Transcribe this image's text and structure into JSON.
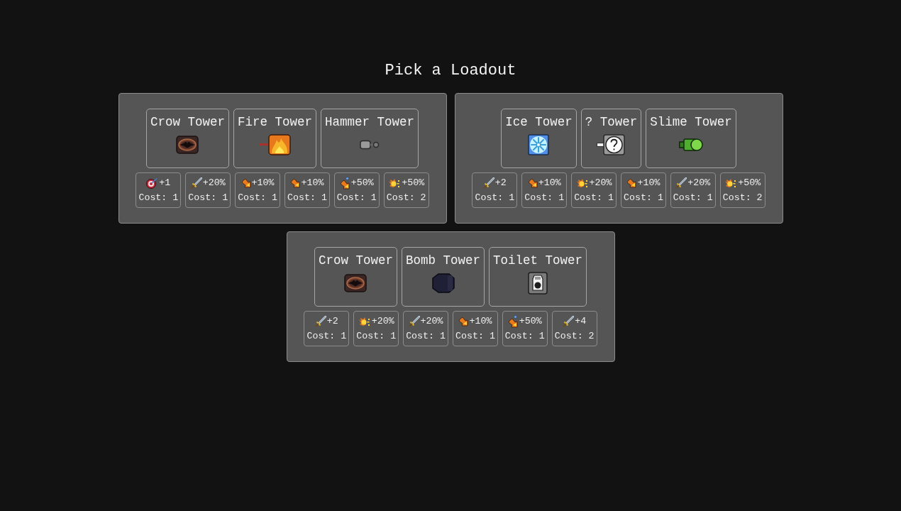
{
  "title": "Pick a Loadout",
  "loadouts": [
    {
      "towers": [
        {
          "name": "Crow Tower",
          "kind": "crow"
        },
        {
          "name": "Fire Tower",
          "kind": "fire"
        },
        {
          "name": "Hammer Tower",
          "kind": "hammer"
        }
      ],
      "upgrades": [
        {
          "kind": "target",
          "bonus": "+1",
          "cost": "Cost: 1"
        },
        {
          "kind": "sword",
          "bonus": "+20%",
          "cost": "Cost: 1"
        },
        {
          "kind": "flame-arrow",
          "bonus": "+10%",
          "cost": "Cost: 1"
        },
        {
          "kind": "flame-arrow",
          "bonus": "+10%",
          "cost": "Cost: 1"
        },
        {
          "kind": "gem-arrow",
          "bonus": "+50%",
          "cost": "Cost: 1"
        },
        {
          "kind": "fireball",
          "bonus": "+50%",
          "cost": "Cost: 2"
        }
      ]
    },
    {
      "towers": [
        {
          "name": "Ice Tower",
          "kind": "ice"
        },
        {
          "name": "? Tower",
          "kind": "mystery"
        },
        {
          "name": "Slime Tower",
          "kind": "slime"
        }
      ],
      "upgrades": [
        {
          "kind": "sword",
          "bonus": "+2",
          "cost": "Cost: 1"
        },
        {
          "kind": "flame-arrow",
          "bonus": "+10%",
          "cost": "Cost: 1"
        },
        {
          "kind": "fireball",
          "bonus": "+20%",
          "cost": "Cost: 1"
        },
        {
          "kind": "flame-arrow",
          "bonus": "+10%",
          "cost": "Cost: 1"
        },
        {
          "kind": "sword",
          "bonus": "+20%",
          "cost": "Cost: 1"
        },
        {
          "kind": "fireball",
          "bonus": "+50%",
          "cost": "Cost: 2"
        }
      ]
    },
    {
      "towers": [
        {
          "name": "Crow Tower",
          "kind": "crow"
        },
        {
          "name": "Bomb Tower",
          "kind": "bomb"
        },
        {
          "name": "Toilet Tower",
          "kind": "toilet"
        }
      ],
      "upgrades": [
        {
          "kind": "sword",
          "bonus": "+2",
          "cost": "Cost: 1"
        },
        {
          "kind": "fireball",
          "bonus": "+20%",
          "cost": "Cost: 1"
        },
        {
          "kind": "sword",
          "bonus": "+20%",
          "cost": "Cost: 1"
        },
        {
          "kind": "flame-arrow",
          "bonus": "+10%",
          "cost": "Cost: 1"
        },
        {
          "kind": "gem-arrow",
          "bonus": "+50%",
          "cost": "Cost: 1"
        },
        {
          "kind": "sword",
          "bonus": "+4",
          "cost": "Cost: 2"
        }
      ]
    }
  ]
}
